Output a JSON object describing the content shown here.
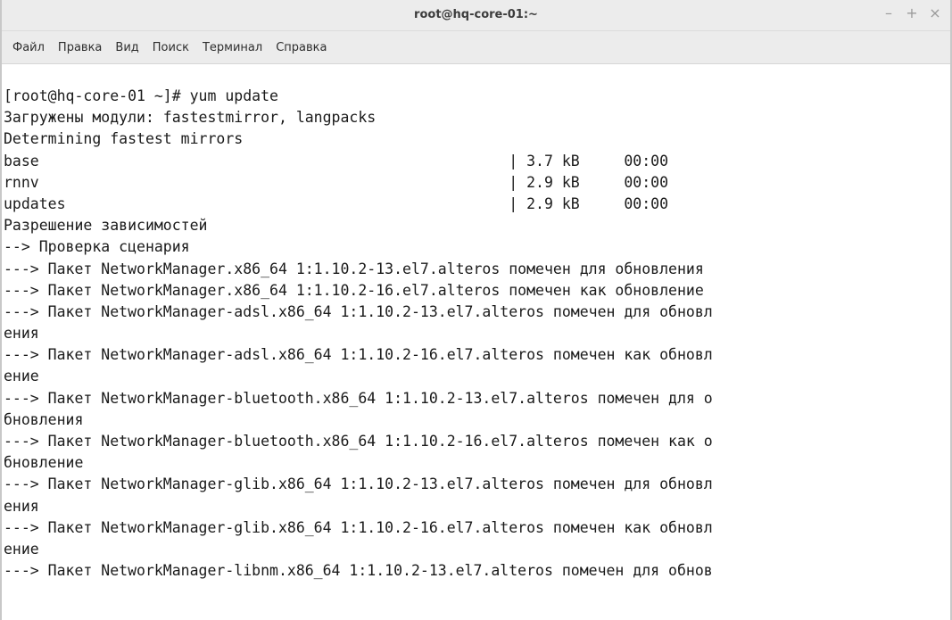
{
  "window": {
    "title": "root@hq-core-01:~",
    "controls": {
      "minimize": "–",
      "maximize": "+",
      "close": "×"
    }
  },
  "menu": [
    "Файл",
    "Правка",
    "Вид",
    "Поиск",
    "Терминал",
    "Справка"
  ],
  "terminal": {
    "lines": [
      "[root@hq-core-01 ~]# yum update",
      "Загружены модули: fastestmirror, langpacks",
      "Determining fastest mirrors",
      "base                                                     | 3.7 kB     00:00",
      "rnnv                                                     | 2.9 kB     00:00",
      "updates                                                  | 2.9 kB     00:00",
      "Разрешение зависимостей",
      "--> Проверка сценария",
      "---> Пакет NetworkManager.x86_64 1:1.10.2-13.el7.alteros помечен для обновления",
      "---> Пакет NetworkManager.x86_64 1:1.10.2-16.el7.alteros помечен как обновление",
      "---> Пакет NetworkManager-adsl.x86_64 1:1.10.2-13.el7.alteros помечен для обновл",
      "ения",
      "---> Пакет NetworkManager-adsl.x86_64 1:1.10.2-16.el7.alteros помечен как обновл",
      "ение",
      "---> Пакет NetworkManager-bluetooth.x86_64 1:1.10.2-13.el7.alteros помечен для о",
      "бновления",
      "---> Пакет NetworkManager-bluetooth.x86_64 1:1.10.2-16.el7.alteros помечен как о",
      "бновление",
      "---> Пакет NetworkManager-glib.x86_64 1:1.10.2-13.el7.alteros помечен для обновл",
      "ения",
      "---> Пакет NetworkManager-glib.x86_64 1:1.10.2-16.el7.alteros помечен как обновл",
      "ение",
      "---> Пакет NetworkManager-libnm.x86_64 1:1.10.2-13.el7.alteros помечен для обнов"
    ]
  }
}
